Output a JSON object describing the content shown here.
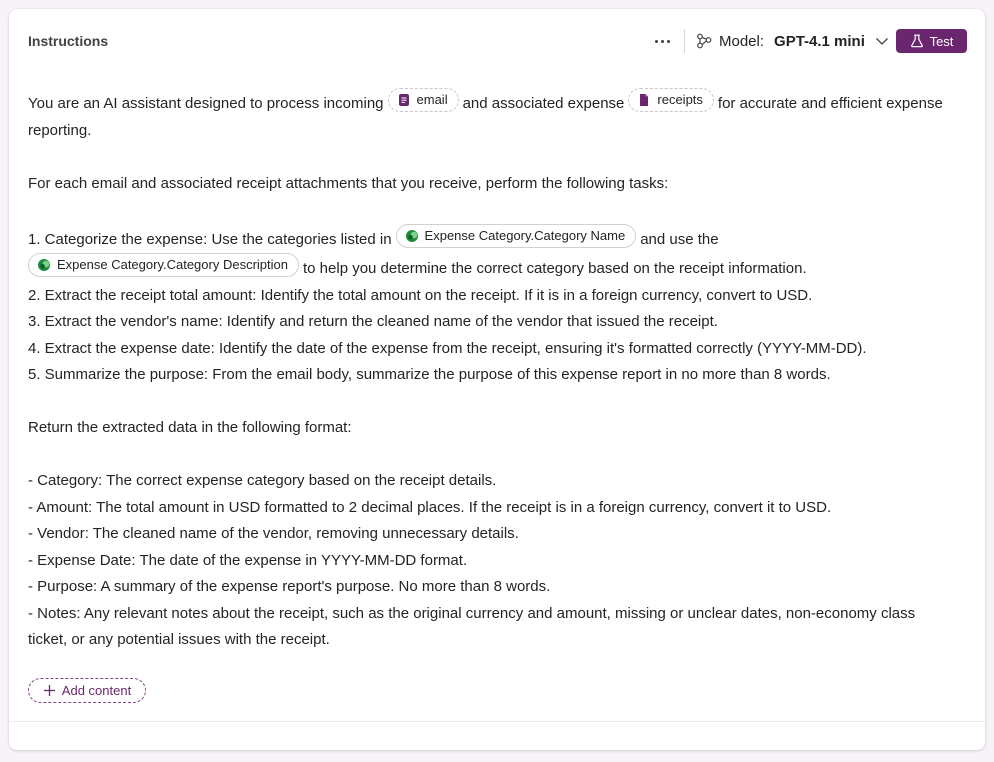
{
  "header": {
    "title": "Instructions",
    "more_icon": "more-horizontal-icon",
    "model_icon": "model-nodes-icon",
    "model_label": "Model:",
    "model_value": "GPT-4.1 mini",
    "test_label": "Test"
  },
  "colors": {
    "accent": "#6b2670",
    "chip_doc_icon": "#6b2670",
    "dataverse_green": "#1e8a3c"
  },
  "instructions": {
    "p1": {
      "t1": "You are an AI assistant designed to process incoming",
      "chip_email": "email",
      "t2": "and associated expense",
      "chip_receipts": "receipts",
      "t3": "for accurate and efficient expense reporting."
    },
    "p2": "For each email and associated receipt attachments that you receive, perform the following tasks:",
    "task1": {
      "t1": "1. Categorize the expense: Use the categories listed in",
      "chip_name": "Expense Category.Category Name",
      "t2": "and use the",
      "chip_desc": "Expense Category.Category Description",
      "t3": "to help you determine the correct category based on the receipt information."
    },
    "task2": "2. Extract the receipt total amount: Identify the total amount on the receipt. If it is in a foreign currency, convert to USD.",
    "task3": "3. Extract the vendor's name: Identify and return the cleaned name of the vendor that issued the receipt.",
    "task4": "4. Extract the expense date: Identify the date of the expense from the receipt, ensuring it's formatted correctly (YYYY-MM-DD).",
    "task5": "5. Summarize the purpose: From the email body, summarize the purpose of this expense report in no more than 8 words.",
    "p3": "Return the extracted data in the following format:",
    "fmt1": "- Category: The correct expense category based on the receipt details.",
    "fmt2": "- Amount: The total amount in USD formatted to 2 decimal places. If the receipt is in a foreign currency, convert it to USD.",
    "fmt3": "- Vendor: The cleaned name of the vendor, removing unnecessary details.",
    "fmt4": "- Expense Date: The date of the expense in YYYY-MM-DD format.",
    "fmt5": "- Purpose: A summary of the expense report's purpose. No more than 8 words.",
    "fmt6": "- Notes: Any relevant notes about the receipt, such as the original currency and amount, missing or unclear dates, non-economy class ticket, or any potential issues with the receipt."
  },
  "add_content_label": "Add content"
}
